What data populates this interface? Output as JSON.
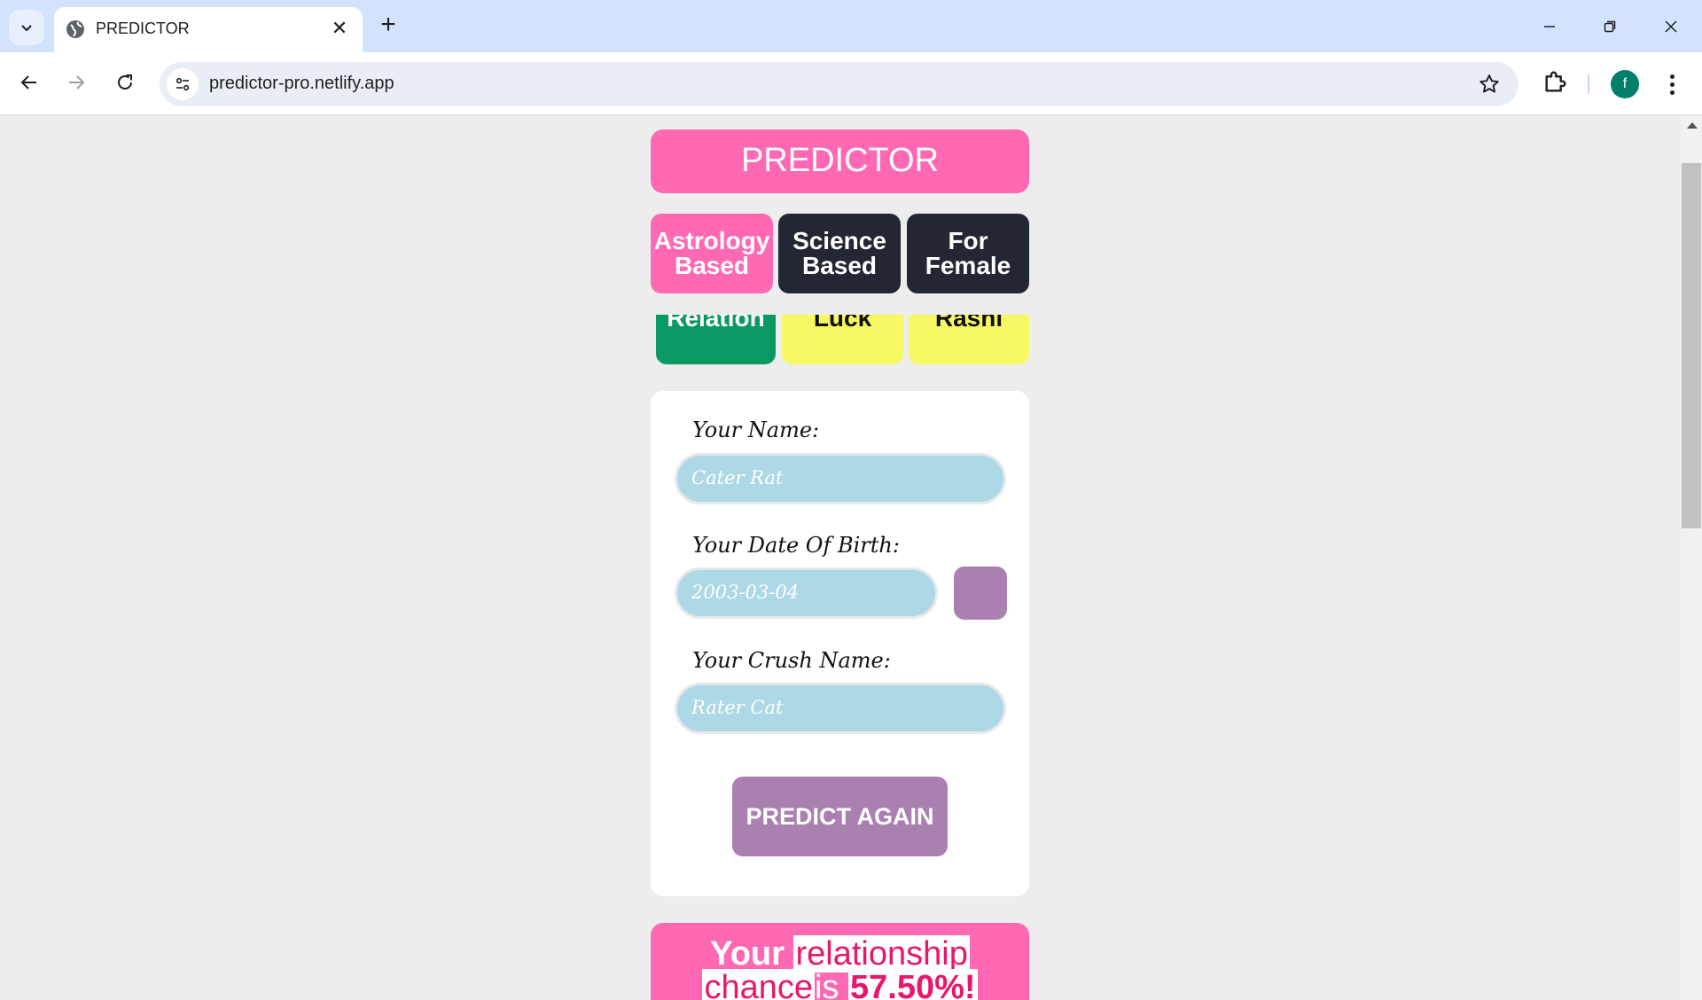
{
  "browser": {
    "tab_title": "PREDICTOR",
    "url": "predictor-pro.netlify.app",
    "profile_initial": "f"
  },
  "app": {
    "title": "PREDICTOR",
    "modes": [
      {
        "line1": "Astrology",
        "line2": "Based",
        "active": true
      },
      {
        "line1": "Science",
        "line2": "Based",
        "active": false
      },
      {
        "line1": "For",
        "line2": "Female",
        "active": false
      }
    ],
    "sub_tabs": [
      {
        "label": "Relation",
        "color": "#089a62"
      },
      {
        "label": "Luck",
        "color": "#f8f962"
      },
      {
        "label": "Rashi",
        "color": "#f8f962"
      }
    ]
  },
  "form": {
    "name_label": "Your Name:",
    "name_value": "Cater Rat",
    "dob_label": "Your Date Of Birth:",
    "dob_value": "2003-03-04",
    "crush_label": "Your Crush Name:",
    "crush_value": "Rater Cat",
    "submit_label": "PREDICT AGAIN"
  },
  "result": {
    "word_your": "Your",
    "word_relationship": "relationship",
    "word_chance": "chance",
    "word_is": "is",
    "value": "57.50%!"
  },
  "colors": {
    "brand_pink": "#ff69b4",
    "dark": "#232633",
    "green": "#089a62",
    "yellow": "#f8f962",
    "purple": "#aa80b0",
    "field_blue": "#add8e6"
  }
}
